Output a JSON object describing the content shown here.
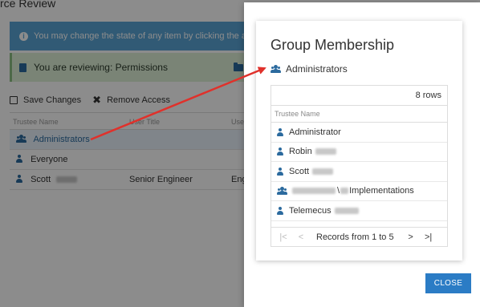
{
  "background": {
    "title_fragment": "rce Review",
    "info_text": "You may change the state of any item by clicking the a",
    "review_label": "You are reviewing: Permissions",
    "path_prefix": "\\\\",
    "toolbar": {
      "save_label": "Save Changes",
      "remove_label": "Remove Access"
    },
    "columns": [
      "Trustee Name",
      "User Title",
      "Use"
    ],
    "rows": [
      {
        "name": "Administrators",
        "title": "",
        "extra": ""
      },
      {
        "name": "Everyone",
        "title": "",
        "extra": ""
      },
      {
        "name": "Scott",
        "title": "Senior Engineer",
        "extra": "Eng"
      }
    ]
  },
  "modal": {
    "title": "Group Membership",
    "group_name": "Administrators",
    "rows_count": "8 rows",
    "column_header": "Trustee Name",
    "members": [
      {
        "name": "Administrator",
        "icon": "user-icon"
      },
      {
        "name": "Robin",
        "icon": "user-icon"
      },
      {
        "name": "Scott",
        "icon": "user-icon"
      },
      {
        "name": "\\",
        "suffix": "Implementations",
        "icon": "group-icon"
      },
      {
        "name": "Telemecus",
        "icon": "user-icon"
      }
    ],
    "pager": {
      "first": "|<",
      "prev": "<",
      "records_text": "Records from 1 to 5",
      "next": ">",
      "last": ">|"
    },
    "close_label": "CLOSE"
  },
  "colors": {
    "accent": "#2b7cc5",
    "info_bar": "#5aa5d6",
    "review_bar": "#dff0d8",
    "arrow": "#e0312b"
  }
}
